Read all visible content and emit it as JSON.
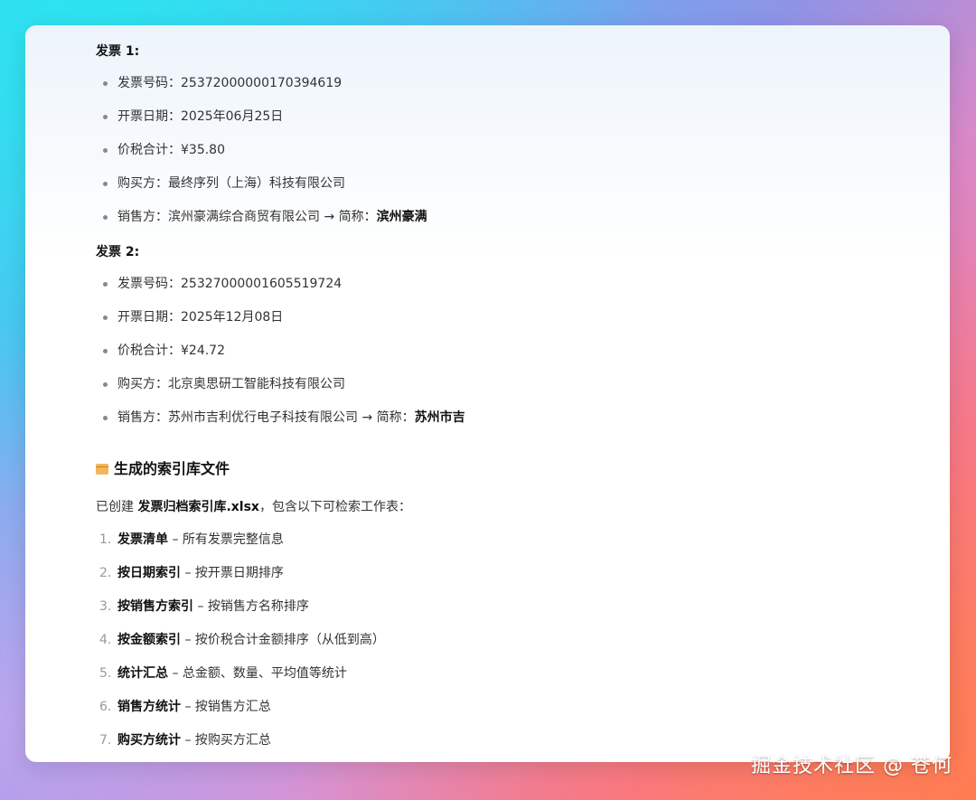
{
  "invoice1": {
    "heading": "发票 1:",
    "items": [
      {
        "label": "发票号码：",
        "value": "25372000000170394619"
      },
      {
        "label": "开票日期：",
        "value": "2025年06月25日"
      },
      {
        "label": "价税合计：",
        "value": "¥35.80"
      },
      {
        "label": "购买方：",
        "value": "最终序列（上海）科技有限公司"
      },
      {
        "label": "销售方：",
        "value": "滨州豪满综合商贸有限公司 → 简称：",
        "strong": "滨州豪满"
      }
    ]
  },
  "invoice2": {
    "heading": "发票 2:",
    "items": [
      {
        "label": "发票号码：",
        "value": "25327000001605519724"
      },
      {
        "label": "开票日期：",
        "value": "2025年12月08日"
      },
      {
        "label": "价税合计：",
        "value": "¥24.72"
      },
      {
        "label": "购买方：",
        "value": "北京奥思研工智能科技有限公司"
      },
      {
        "label": "销售方：",
        "value": "苏州市吉利优行电子科技有限公司 → 简称：",
        "strong": "苏州市吉"
      }
    ]
  },
  "index_section": {
    "title": "生成的索引库文件",
    "intro_prefix": "已创建 ",
    "intro_file": "发票归档索引库.xlsx",
    "intro_suffix": "，包含以下可检索工作表：",
    "sheets": [
      {
        "num": "1.",
        "name": "发票清单",
        "desc": " – 所有发票完整信息"
      },
      {
        "num": "2.",
        "name": "按日期索引",
        "desc": " – 按开票日期排序"
      },
      {
        "num": "3.",
        "name": "按销售方索引",
        "desc": " – 按销售方名称排序"
      },
      {
        "num": "4.",
        "name": "按金额索引",
        "desc": " – 按价税合计金额排序（从低到高）"
      },
      {
        "num": "5.",
        "name": "统计汇总",
        "desc": " – 总金额、数量、平均值等统计"
      },
      {
        "num": "6.",
        "name": "销售方统计",
        "desc": " – 按销售方汇总"
      },
      {
        "num": "7.",
        "name": "购买方统计",
        "desc": " – 按购买方汇总"
      }
    ]
  },
  "watermark": "掘金技术社区 @ 苍何",
  "icons": {
    "section_icon": "box-icon"
  }
}
